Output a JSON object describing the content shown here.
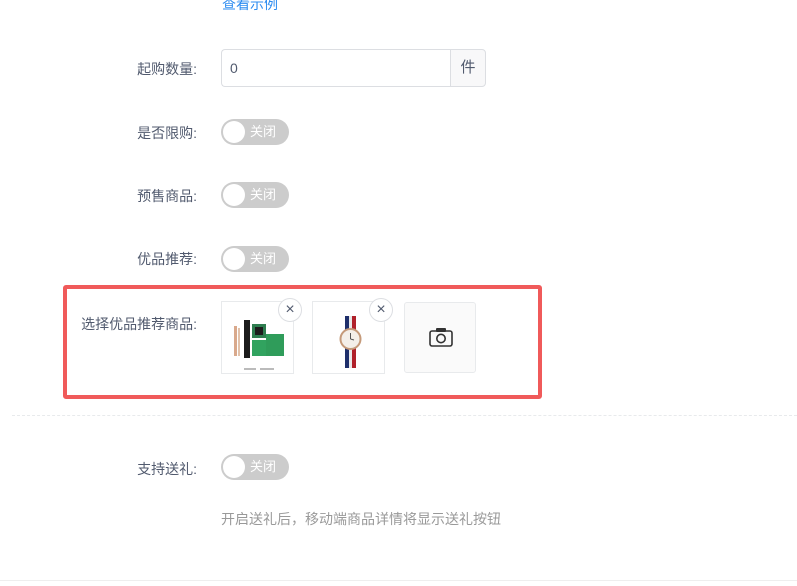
{
  "top_link": "查看示例",
  "min_purchase": {
    "label": "起购数量:",
    "value": "0",
    "unit": "件"
  },
  "limit_purchase": {
    "label": "是否限购:",
    "switch_text": "关闭"
  },
  "presale": {
    "label": "预售商品:",
    "switch_text": "关闭"
  },
  "recommend": {
    "label": "优品推荐:",
    "switch_text": "关闭"
  },
  "recommend_goods": {
    "label": "选择优品推荐商品:",
    "remove_icon": "×",
    "upload_icon": "camera-icon",
    "thumb1_brand": "LOLA ROSE"
  },
  "gift": {
    "label": "支持送礼:",
    "switch_text": "关闭",
    "hint": "开启送礼后，移动端商品详情将显示送礼按钮"
  },
  "colors": {
    "accent": "#2d8cf0",
    "highlight": "#f05a5a",
    "switch_off": "#cccccc"
  }
}
